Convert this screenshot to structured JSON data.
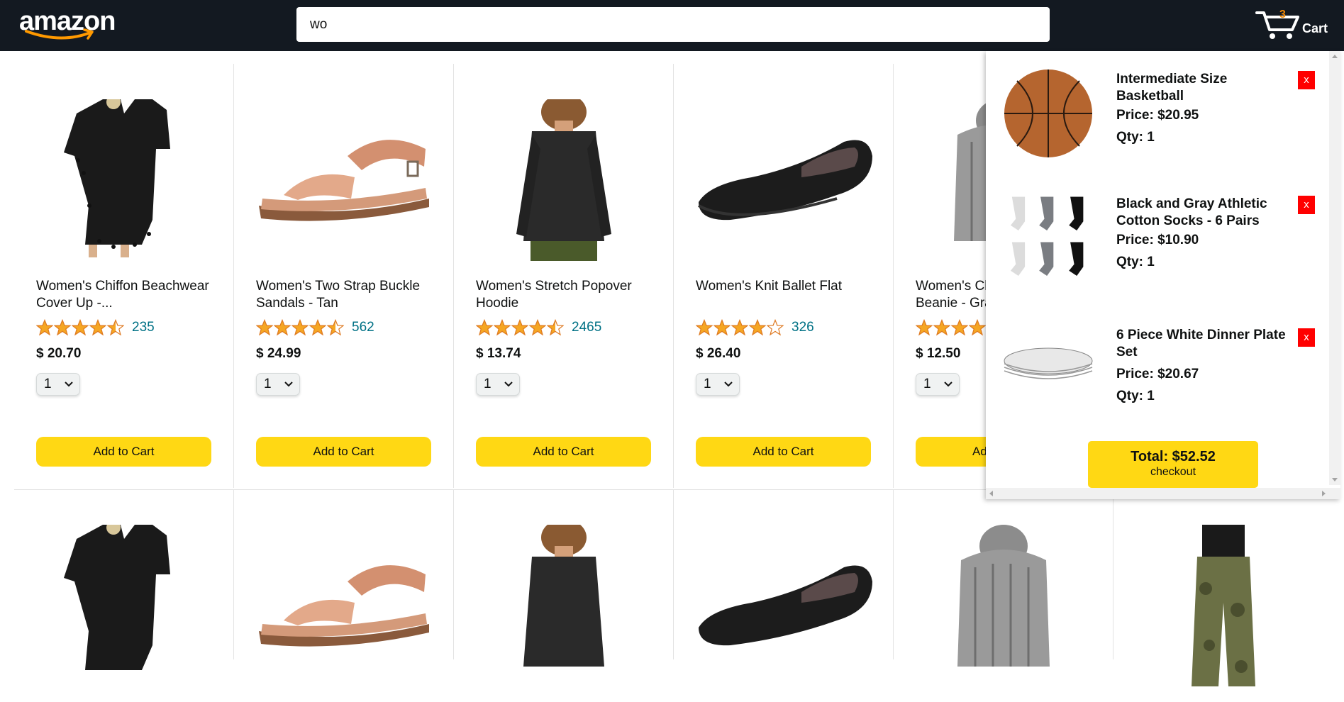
{
  "header": {
    "logo_text": "amazon",
    "search_value": "wo",
    "cart_count": "3",
    "cart_label": "Cart"
  },
  "products_row1": [
    {
      "name": "Women's Chiffon Beachwear Cover Up -...",
      "rating": 4.5,
      "reviews": "235",
      "price": "$ 20.70",
      "qty": "1",
      "button": "Add to Cart",
      "icon": "cover-up-image"
    },
    {
      "name": "Women's Two Strap Buckle Sandals - Tan",
      "rating": 4.5,
      "reviews": "562",
      "price": "$ 24.99",
      "qty": "1",
      "button": "Add to Cart",
      "icon": "sandal-image"
    },
    {
      "name": "Women's Stretch Popover Hoodie",
      "rating": 4.5,
      "reviews": "2465",
      "price": "$ 13.74",
      "qty": "1",
      "button": "Add to Cart",
      "icon": "hoodie-image"
    },
    {
      "name": "Women's Knit Ballet Flat",
      "rating": 4,
      "reviews": "326",
      "price": "$ 26.40",
      "qty": "1",
      "button": "Add to Cart",
      "icon": "ballet-flat-image"
    },
    {
      "name": "Women's Ch",
      "name_line2": "Beanie - Gra",
      "rating": 4,
      "reviews": "",
      "price": "$ 12.50",
      "qty": "1",
      "button": "Ad",
      "icon": "beanie-image"
    }
  ],
  "cart": {
    "items": [
      {
        "name": "Intermediate Size Basketball",
        "price": "Price: $20.95",
        "qty": "Qty: 1",
        "remove": "x",
        "icon": "basketball-image"
      },
      {
        "name": "Black and Gray Athletic Cotton Socks - 6 Pairs",
        "price": "Price: $10.90",
        "qty": "Qty: 1",
        "remove": "x",
        "icon": "socks-image"
      },
      {
        "name": "6 Piece White Dinner Plate Set",
        "price": "Price: $20.67",
        "qty": "Qty: 1",
        "remove": "x",
        "icon": "plates-image"
      }
    ],
    "total": "Total: $52.52",
    "checkout": "checkout"
  },
  "colors": {
    "header_bg": "#131921",
    "button_yellow": "#ffd814",
    "review_link": "#007185",
    "star": "#f5a623",
    "remove_red": "#ff0000",
    "cart_count": "#f08804"
  }
}
